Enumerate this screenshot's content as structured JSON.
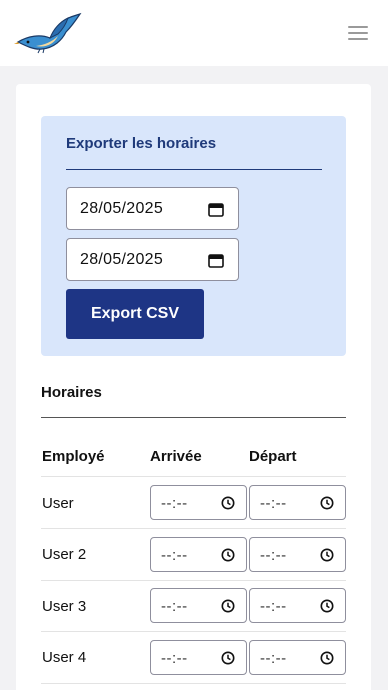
{
  "header": {
    "logo_icon": "bluebird-logo-icon",
    "menu_icon": "hamburger-menu-icon"
  },
  "export": {
    "title": "Exporter les horaires",
    "start_date": "28/05/2025",
    "end_date": "28/05/2025",
    "button_label": "Export CSV"
  },
  "schedule": {
    "title": "Horaires",
    "columns": [
      "Employé",
      "Arrivée",
      "Départ"
    ],
    "time_placeholder": "--:--",
    "rows": [
      {
        "name": "User",
        "arrival": "--:--",
        "departure": "--:--"
      },
      {
        "name": "User 2",
        "arrival": "--:--",
        "departure": "--:--"
      },
      {
        "name": "User 3",
        "arrival": "--:--",
        "departure": "--:--"
      },
      {
        "name": "User 4",
        "arrival": "--:--",
        "departure": "--:--"
      }
    ]
  },
  "colors": {
    "accent": "#1e3585",
    "panel": "#d9e6fb",
    "title": "#1f3a7a"
  }
}
